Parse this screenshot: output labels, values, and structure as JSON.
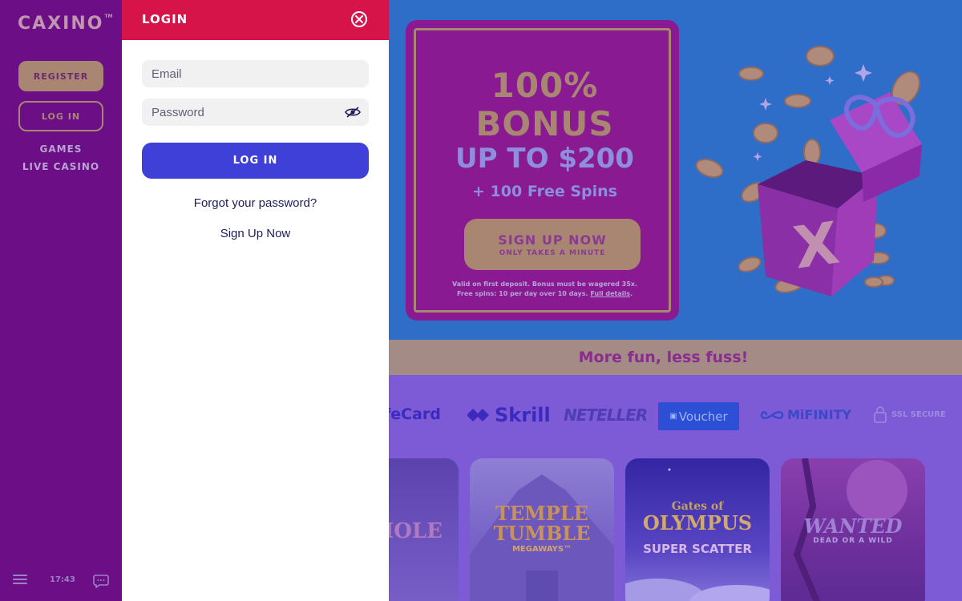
{
  "sidebar": {
    "logo": "CAXINO",
    "logo_mark": "TM",
    "register_label": "REGISTER",
    "login_label": "LOG IN",
    "nav": [
      "GAMES",
      "LIVE CASINO"
    ],
    "clock": "17:43",
    "icons": {
      "menu": "hamburger-menu-icon",
      "chat": "chat-bubble-icon"
    }
  },
  "hero": {
    "bonus_percent": "100%",
    "bonus_word": "BONUS",
    "bonus_upto": "UP TO $200",
    "bonus_spins": "+ 100 Free Spins",
    "signup_label": "SIGN UP NOW",
    "signup_sub": "ONLY TAKES A MINUTE",
    "terms_line1": "Valid on first deposit. Bonus must be wagered 35x.",
    "terms_line2": "Free spins: 10 per day over 10 days.",
    "terms_link": "Full details"
  },
  "tagline": "More fun, less fuss!",
  "payments": {
    "safecard": "feCard",
    "skrill": "Skrill",
    "neteller": "NETELLER",
    "voucher": "Voucher",
    "mifinity": "MiFINITY",
    "ssl": "SSL SECURE"
  },
  "games": [
    {
      "title": "HOLE"
    },
    {
      "title_line1": "TEMPLE",
      "title_line2": "TUMBLE",
      "sub": "MEGAWAYS™"
    },
    {
      "title": "Gates of",
      "main": "OLYMPUS",
      "sub": "SUPER SCATTER"
    },
    {
      "title": "WANTED",
      "sub": "DEAD OR A WILD"
    }
  ],
  "login_drawer": {
    "title": "LOGIN",
    "email_placeholder": "Email",
    "password_placeholder": "Password",
    "submit_label": "LOG IN",
    "forgot_label": "Forgot your password?",
    "signup_label": "Sign Up Now"
  },
  "colors": {
    "sidebar_bg": "#6c0e85",
    "hero_bg": "#2e6ec9",
    "drawer_header": "#d7144a",
    "login_button": "#3f40d8",
    "accent_tan": "#a98672"
  }
}
